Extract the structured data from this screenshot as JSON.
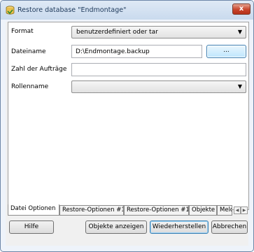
{
  "window": {
    "title": "Restore database \"Endmontage\"",
    "close_glyph": "x",
    "icon": "database-restore-icon"
  },
  "form": {
    "format_label": "Format",
    "format_value": "benutzerdefiniert oder tar",
    "filename_label": "Dateiname",
    "filename_value": "D:\\Endmontage.backup",
    "browse_label": "...",
    "jobs_label": "Zahl der Aufträge",
    "jobs_value": "",
    "role_label": "Rollenname",
    "role_value": ""
  },
  "tabs": [
    {
      "label": "Datei Optionen",
      "active": true
    },
    {
      "label": "Restore-Optionen #1",
      "active": false
    },
    {
      "label": "Restore-Optionen #1",
      "active": false
    },
    {
      "label": "Objekte",
      "active": false
    },
    {
      "label": "Meld",
      "active": false
    }
  ],
  "buttons": {
    "help": "Hilfe",
    "show_objects": "Objekte anzeigen",
    "restore": "Wiederherstellen",
    "cancel": "Abbrechen"
  }
}
